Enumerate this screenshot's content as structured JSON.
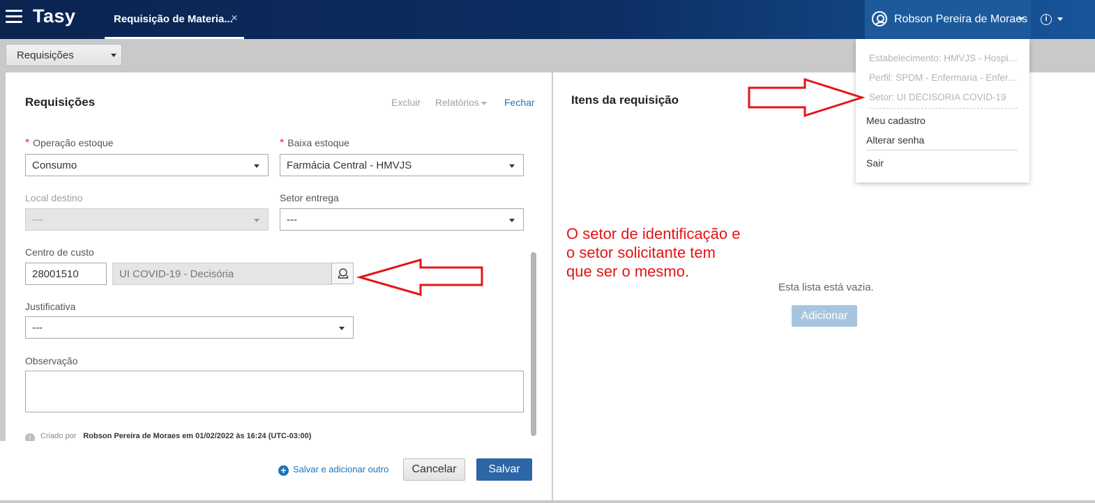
{
  "header": {
    "logo": "Tasy",
    "tab_label": "Requisição de Materia...",
    "tab_close": "×",
    "user_name": "Robson Pereira de Moraes",
    "info_icon_label": "i"
  },
  "toolbar": {
    "menu_button": "Requisições"
  },
  "form": {
    "title": "Requisições",
    "actions": {
      "delete": "Excluir",
      "reports": "Relatórios",
      "close": "Fechar"
    },
    "operacao_estoque": {
      "label": "Operação estoque",
      "value": "Consumo",
      "required": true
    },
    "baixa_estoque": {
      "label": "Baixa estoque",
      "value": "Farmácia Central - HMVJS",
      "required": true
    },
    "local_destino": {
      "label": "Local destino",
      "value": "---"
    },
    "setor_entrega": {
      "label": "Setor entrega",
      "value": "---"
    },
    "centro_custo": {
      "label": "Centro de custo",
      "code": "28001510",
      "description": "UI COVID-19 - Decisória"
    },
    "justificativa": {
      "label": "Justificativa",
      "value": "---"
    },
    "observacao": {
      "label": "Observação",
      "value": ""
    },
    "meta": {
      "created_by_label": "Criado por",
      "created_by_value": "Robson Pereira de Moraes em 01/02/2022 às 16:24 (UTC-03:00)"
    },
    "buttons": {
      "save_add": "Salvar e adicionar outro",
      "cancel": "Cancelar",
      "save": "Salvar"
    },
    "required_mark": "*"
  },
  "items": {
    "title": "Itens da requisição",
    "empty_text": "Esta lista está vazia.",
    "add_button": "Adicionar"
  },
  "user_dropdown": {
    "estabelecimento": "Estabelecimento: HMVJS - Hospital Municipal",
    "perfil": "Perfil: SPDM - Enfermaria - Enfermeiro",
    "setor": "Setor: UI DECISORIA COVID-19",
    "meu_cadastro": "Meu cadastro",
    "alterar_senha": "Alterar senha",
    "sair": "Sair"
  },
  "annotation": {
    "line1": "O setor de identificação e",
    "line2": "o setor solicitante tem",
    "line3": "que ser o mesmo.",
    "color": "#e41414"
  },
  "colors": {
    "header_dark": "#0b2450",
    "header_user": "#1c5a9c",
    "primary_button": "#2b66a6",
    "link": "#1b75bb",
    "required": "#e02020"
  }
}
